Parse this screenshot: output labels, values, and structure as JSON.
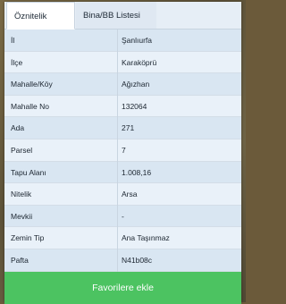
{
  "tabs": [
    {
      "label": "Öznitelik Bilgisi",
      "active": true
    },
    {
      "label": "Bina/BB Listesi",
      "active": false
    }
  ],
  "rows": [
    {
      "key": "İl",
      "value": "Şanlıurfa"
    },
    {
      "key": "İlçe",
      "value": "Karaköprü"
    },
    {
      "key": "Mahalle/Köy",
      "value": "Ağızhan"
    },
    {
      "key": "Mahalle No",
      "value": "132064"
    },
    {
      "key": "Ada",
      "value": "271"
    },
    {
      "key": "Parsel",
      "value": "7"
    },
    {
      "key": "Tapu Alanı",
      "value": "1.008,16"
    },
    {
      "key": "Nitelik",
      "value": "Arsa"
    },
    {
      "key": "Mevkii",
      "value": "-"
    },
    {
      "key": "Zemin Tip",
      "value": "Ana Taşınmaz"
    },
    {
      "key": "Pafta",
      "value": "N41b08c"
    }
  ],
  "favorite_button": "Favorilere ekle",
  "colors": {
    "accent_green": "#4cc361",
    "row_odd": "#d9e6f2",
    "row_even": "#e9f1f9"
  }
}
